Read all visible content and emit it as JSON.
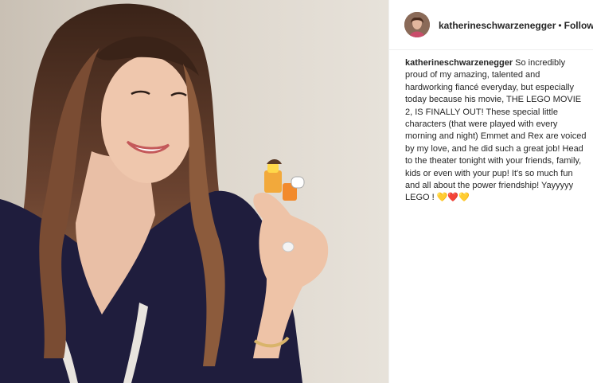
{
  "post": {
    "username": "katherineschwarzenegger",
    "separator": "•",
    "follow_label": "Following",
    "caption_user": "katherineschwarzenegger",
    "caption_text": "So incredibly proud of my amazing, talented and hardworking fiancé everyday, but especially today because his movie, THE LEGO MOVIE 2, IS FINALLY OUT! These special little characters (that were played with every morning and night) Emmet and Rex are voiced by my love, and he did such a great job! Head to the theater tonight with your friends, family, kids or even with your pup! It's so much fun and all about the power friendship! Yayyyyy LEGO ! 💛❤️💛"
  },
  "colors": {
    "text": "#262626",
    "divider": "#efefef",
    "robe": "#1f1d3d"
  }
}
